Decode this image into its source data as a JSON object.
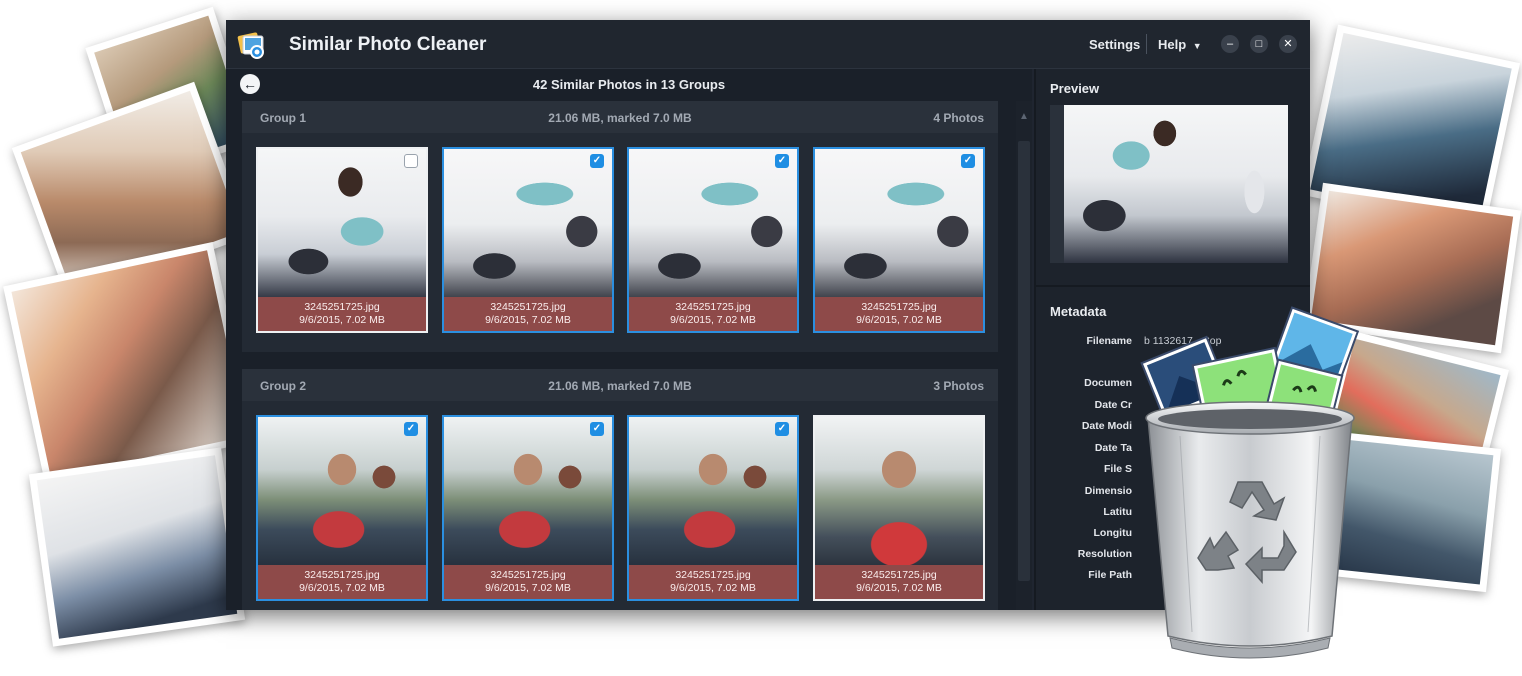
{
  "app": {
    "title": "Similar Photo Cleaner",
    "menu": {
      "settings": "Settings",
      "help": "Help"
    },
    "window_controls": {
      "minimize": "–",
      "maximize": "□",
      "close": "✕"
    }
  },
  "main": {
    "back_icon": "←",
    "summary": "42  Similar Photos in 13  Groups",
    "groups": [
      {
        "name": "Group 1",
        "size": "21.06 MB, marked 7.0 MB",
        "count": "4 Photos",
        "photos": [
          {
            "filename": "3245251725.jpg",
            "info": "9/6/2015, 7.02 MB",
            "checked": false
          },
          {
            "filename": "3245251725.jpg",
            "info": "9/6/2015, 7.02 MB",
            "checked": true
          },
          {
            "filename": "3245251725.jpg",
            "info": "9/6/2015, 7.02 MB",
            "checked": true
          },
          {
            "filename": "3245251725.jpg",
            "info": "9/6/2015, 7.02 MB",
            "checked": true
          }
        ]
      },
      {
        "name": "Group 2",
        "size": "21.06 MB, marked 7.0 MB",
        "count": "3 Photos",
        "photos": [
          {
            "filename": "3245251725.jpg",
            "info": "9/6/2015, 7.02 MB",
            "checked": true
          },
          {
            "filename": "3245251725.jpg",
            "info": "9/6/2015, 7.02 MB",
            "checked": true
          },
          {
            "filename": "3245251725.jpg",
            "info": "9/6/2015, 7.02 MB",
            "checked": true
          },
          {
            "filename": "3245251725.jpg",
            "info": "9/6/2015, 7.02 MB",
            "checked": false
          }
        ]
      }
    ]
  },
  "preview": {
    "title": "Preview"
  },
  "metadata": {
    "title": "Metadata",
    "rows": [
      {
        "label": "Filename",
        "value": "b        1132617 - Cop"
      },
      {
        "label": "Documen",
        "value": ""
      },
      {
        "label": "Date Cr",
        "value": ""
      },
      {
        "label": "Date Modi",
        "value": ""
      },
      {
        "label": "Date Ta",
        "value": ""
      },
      {
        "label": "File S",
        "value": ""
      },
      {
        "label": "Dimensio",
        "value": ""
      },
      {
        "label": "Latitu",
        "value": ""
      },
      {
        "label": "Longitu",
        "value": ""
      },
      {
        "label": "Resolution",
        "value": ""
      },
      {
        "label": "File Path",
        "value": ""
      }
    ]
  },
  "colors": {
    "accent": "#2b8fe0",
    "caption_bg": "#8e4a49",
    "window_bg": "#1f2530"
  },
  "icons": [
    "app-logo-icon",
    "back-arrow-icon",
    "chevron-down-icon",
    "minimize-icon",
    "maximize-icon",
    "close-icon",
    "checkbox-icon",
    "recycle-bin-icon"
  ]
}
